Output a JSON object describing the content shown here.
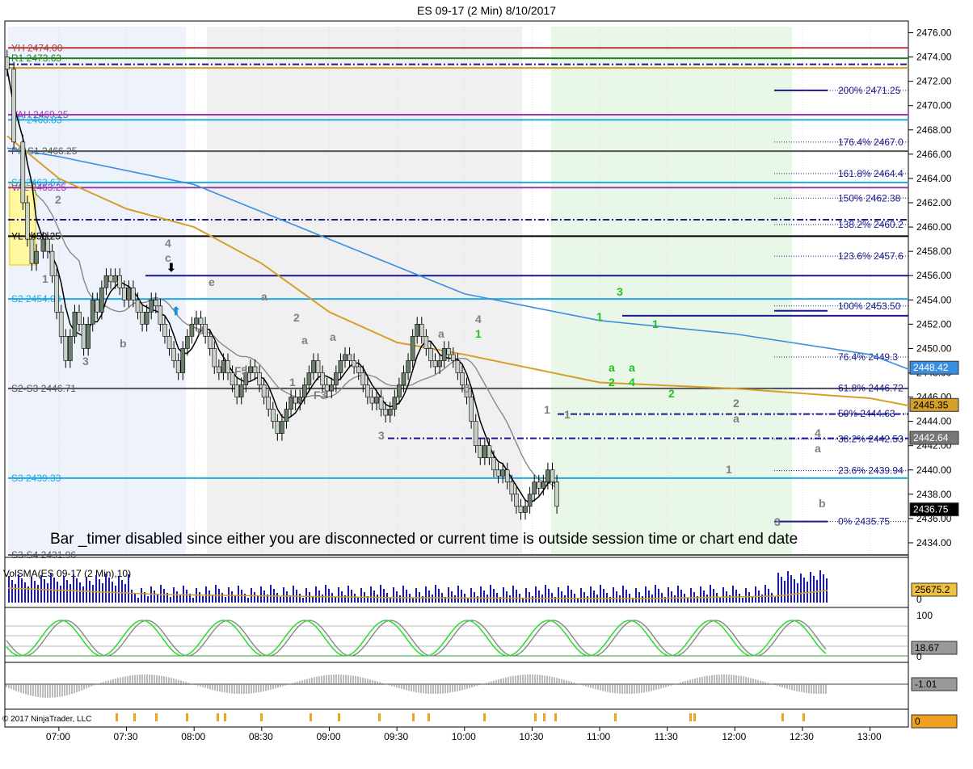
{
  "title": "ES 09-17 (2 Min)  8/10/2017",
  "message": "Bar _timer disabled since either you are disconnected or current time is outside session time or chart end date",
  "copyright": "© 2017 NinjaTrader, LLC",
  "volume_label": "VolSMA(ES 09-17 (2 Min),10)",
  "colors": {
    "up_bar": "#6b7e6b",
    "down_bar": "#b8c4b8",
    "ema_black": "#000000",
    "sma_gray": "#888888",
    "sma_gold": "#d4a02a",
    "sma_blue": "#3a8ee0",
    "green_zone": "#e8f7e8",
    "gray_zone": "#f0f0f0",
    "blue_zone": "#eef2fb"
  },
  "chart_data": {
    "type": "candlestick",
    "price_axis": {
      "ylim": [
        2433,
        2476.5
      ],
      "ticks": [
        "2476.00",
        "2474.00",
        "2472.00",
        "2470.00",
        "2468.00",
        "2466.00",
        "2464.00",
        "2462.00",
        "2460.00",
        "2458.00",
        "2456.00",
        "2454.00",
        "2452.00",
        "2450.00",
        "2448.00",
        "2446.00",
        "2444.00",
        "2442.00",
        "2440.00",
        "2438.00",
        "2436.00",
        "2434.00"
      ],
      "tick_values": [
        2476,
        2474,
        2472,
        2470,
        2468,
        2466,
        2464,
        2462,
        2460,
        2458,
        2456,
        2454,
        2452,
        2450,
        2448,
        2446,
        2444,
        2442,
        2440,
        2438,
        2436,
        2434
      ]
    },
    "time_axis": {
      "labels": [
        "07:00",
        "07:30",
        "08:00",
        "08:30",
        "09:00",
        "09:30",
        "10:00",
        "10:30",
        "11:00",
        "11:30",
        "12:00",
        "12:30",
        "13:00"
      ],
      "minutes": [
        420,
        450,
        480,
        510,
        540,
        570,
        600,
        630,
        660,
        690,
        720,
        750,
        780
      ],
      "xlim": [
        396,
        797
      ]
    },
    "close_path": [
      [
        397,
        2473
      ],
      [
        400,
        2467
      ],
      [
        404,
        2462
      ],
      [
        406,
        2459
      ],
      [
        408,
        2457
      ],
      [
        410,
        2458
      ],
      [
        413,
        2459
      ],
      [
        415,
        2458
      ],
      [
        417,
        2456
      ],
      [
        419,
        2453
      ],
      [
        421,
        2451
      ],
      [
        423,
        2449
      ],
      [
        425,
        2451
      ],
      [
        427,
        2453
      ],
      [
        429,
        2452
      ],
      [
        431,
        2450
      ],
      [
        433,
        2452
      ],
      [
        435,
        2454
      ],
      [
        437,
        2453
      ],
      [
        439,
        2455
      ],
      [
        441,
        2456
      ],
      [
        443,
        2455.5
      ],
      [
        445,
        2456
      ],
      [
        447,
        2455
      ],
      [
        449,
        2454
      ],
      [
        451,
        2455
      ],
      [
        453,
        2454
      ],
      [
        455,
        2453
      ],
      [
        457,
        2452
      ],
      [
        459,
        2453
      ],
      [
        461,
        2454
      ],
      [
        463,
        2453.5
      ],
      [
        465,
        2452
      ],
      [
        467,
        2451
      ],
      [
        469,
        2450
      ],
      [
        471,
        2449
      ],
      [
        473,
        2448
      ],
      [
        475,
        2450
      ],
      [
        477,
        2451
      ],
      [
        479,
        2452
      ],
      [
        481,
        2452.5
      ],
      [
        483,
        2452
      ],
      [
        485,
        2451
      ],
      [
        487,
        2450
      ],
      [
        489,
        2448.5
      ],
      [
        491,
        2448
      ],
      [
        493,
        2449
      ],
      [
        495,
        2448
      ],
      [
        497,
        2447
      ],
      [
        499,
        2446
      ],
      [
        501,
        2447
      ],
      [
        503,
        2448
      ],
      [
        505,
        2448.5
      ],
      [
        507,
        2448
      ],
      [
        509,
        2447
      ],
      [
        511,
        2446
      ],
      [
        513,
        2445
      ],
      [
        515,
        2444
      ],
      [
        517,
        2443
      ],
      [
        519,
        2444
      ],
      [
        521,
        2445
      ],
      [
        523,
        2446
      ],
      [
        525,
        2445.5
      ],
      [
        527,
        2446
      ],
      [
        529,
        2447
      ],
      [
        531,
        2448
      ],
      [
        533,
        2449
      ],
      [
        535,
        2448
      ],
      [
        537,
        2447
      ],
      [
        539,
        2446.5
      ],
      [
        541,
        2447
      ],
      [
        543,
        2448
      ],
      [
        545,
        2449
      ],
      [
        547,
        2449.5
      ],
      [
        549,
        2449
      ],
      [
        551,
        2448.5
      ],
      [
        553,
        2448
      ],
      [
        555,
        2447
      ],
      [
        557,
        2446
      ],
      [
        559,
        2445.5
      ],
      [
        561,
        2446
      ],
      [
        563,
        2445
      ],
      [
        565,
        2444.5
      ],
      [
        567,
        2445
      ],
      [
        569,
        2446
      ],
      [
        571,
        2447
      ],
      [
        573,
        2448
      ],
      [
        575,
        2449
      ],
      [
        577,
        2451
      ],
      [
        579,
        2452
      ],
      [
        581,
        2451
      ],
      [
        583,
        2450
      ],
      [
        585,
        2449
      ],
      [
        587,
        2448.5
      ],
      [
        589,
        2449
      ],
      [
        591,
        2450
      ],
      [
        593,
        2449.5
      ],
      [
        595,
        2449
      ],
      [
        597,
        2448
      ],
      [
        599,
        2447
      ],
      [
        601,
        2446
      ],
      [
        603,
        2444
      ],
      [
        605,
        2442
      ],
      [
        607,
        2441
      ],
      [
        609,
        2442
      ],
      [
        611,
        2441
      ],
      [
        613,
        2440
      ],
      [
        615,
        2439.5
      ],
      [
        617,
        2440
      ],
      [
        619,
        2439
      ],
      [
        621,
        2438
      ],
      [
        623,
        2437
      ],
      [
        625,
        2436.5
      ],
      [
        627,
        2437
      ],
      [
        629,
        2438
      ],
      [
        631,
        2439
      ],
      [
        633,
        2438.5
      ],
      [
        635,
        2439
      ],
      [
        637,
        2440
      ],
      [
        639,
        2439
      ],
      [
        641,
        2437
      ]
    ],
    "series": [
      {
        "name": "EMA",
        "color": "#000000"
      },
      {
        "name": "SMA fast",
        "color": "#888888"
      },
      {
        "name": "SMA slow",
        "color": "#d4a02a"
      },
      {
        "name": "SMA long",
        "color": "#3a8ee0"
      }
    ],
    "levels": [
      {
        "label": "YH 2474.00",
        "value": 2474.75,
        "color": "#b03a3a"
      },
      {
        "label": "R1 2473.63",
        "value": 2473.9,
        "color": "#208020"
      },
      {
        "label": "VAH 2469.25",
        "value": 2469.25,
        "color": "#9b3ab0"
      },
      {
        "label": "PP 2468.83",
        "value": 2468.83,
        "color": "#22a9e0"
      },
      {
        "label": "PP-S1 2466.25",
        "value": 2466.25,
        "color": "#555555"
      },
      {
        "label": "S1 2463.67",
        "value": 2463.67,
        "color": "#22a9e0"
      },
      {
        "label": "VAL 2463.25",
        "value": 2463.25,
        "color": "#9b3ab0"
      },
      {
        "label": "YL 2459.25",
        "value": 2459.25,
        "color": "#000000"
      },
      {
        "label": "S2 2454.08",
        "value": 2454.08,
        "color": "#22a9e0"
      },
      {
        "label": "S2-S3 2446.71",
        "value": 2446.71,
        "color": "#555555"
      },
      {
        "label": "S3 2439.33",
        "value": 2439.33,
        "color": "#22a9e0"
      },
      {
        "label": "S3-S4 2431.96",
        "value": 2433.0,
        "color": "#555555"
      }
    ],
    "fib_levels": [
      {
        "label": "200%  2471.25",
        "value": 2471.25
      },
      {
        "label": "176.4%  2467.0",
        "value": 2467.0
      },
      {
        "label": "161.8%  2464.4",
        "value": 2464.4
      },
      {
        "label": "150%  2462.38",
        "value": 2462.38
      },
      {
        "label": "138.2%  2460.2",
        "value": 2460.2
      },
      {
        "label": "123.6%  2457.6",
        "value": 2457.6
      },
      {
        "label": "100%  2453.50",
        "value": 2453.5
      },
      {
        "label": "76.4%  2449.3",
        "value": 2449.3
      },
      {
        "label": "61.8%  2446.72",
        "value": 2446.72
      },
      {
        "label": "50%  2444.63",
        "value": 2444.63
      },
      {
        "label": "38.2%  2442.53",
        "value": 2442.53
      },
      {
        "label": "23.6%  2439.94",
        "value": 2439.94
      },
      {
        "label": "0%  2435.75",
        "value": 2435.75
      }
    ],
    "price_tags": [
      {
        "label": "2448.42",
        "value": 2448.42,
        "bg": "#3a8ee0",
        "fg": "#ffffff"
      },
      {
        "label": "2445.35",
        "value": 2445.35,
        "bg": "#d4a02a",
        "fg": "#000000"
      },
      {
        "label": "2442.64",
        "value": 2442.64,
        "bg": "#777777",
        "fg": "#ffffff"
      },
      {
        "label": "2436.75",
        "value": 2436.75,
        "bg": "#000000",
        "fg": "#ffffff"
      }
    ],
    "volume_tag": "25675.2",
    "volume_axis": [
      "0"
    ],
    "osc_axis": [
      "100",
      "0"
    ],
    "osc_tag": "18.67",
    "macd_tag": "-1.01",
    "bottom_tag": "0"
  }
}
